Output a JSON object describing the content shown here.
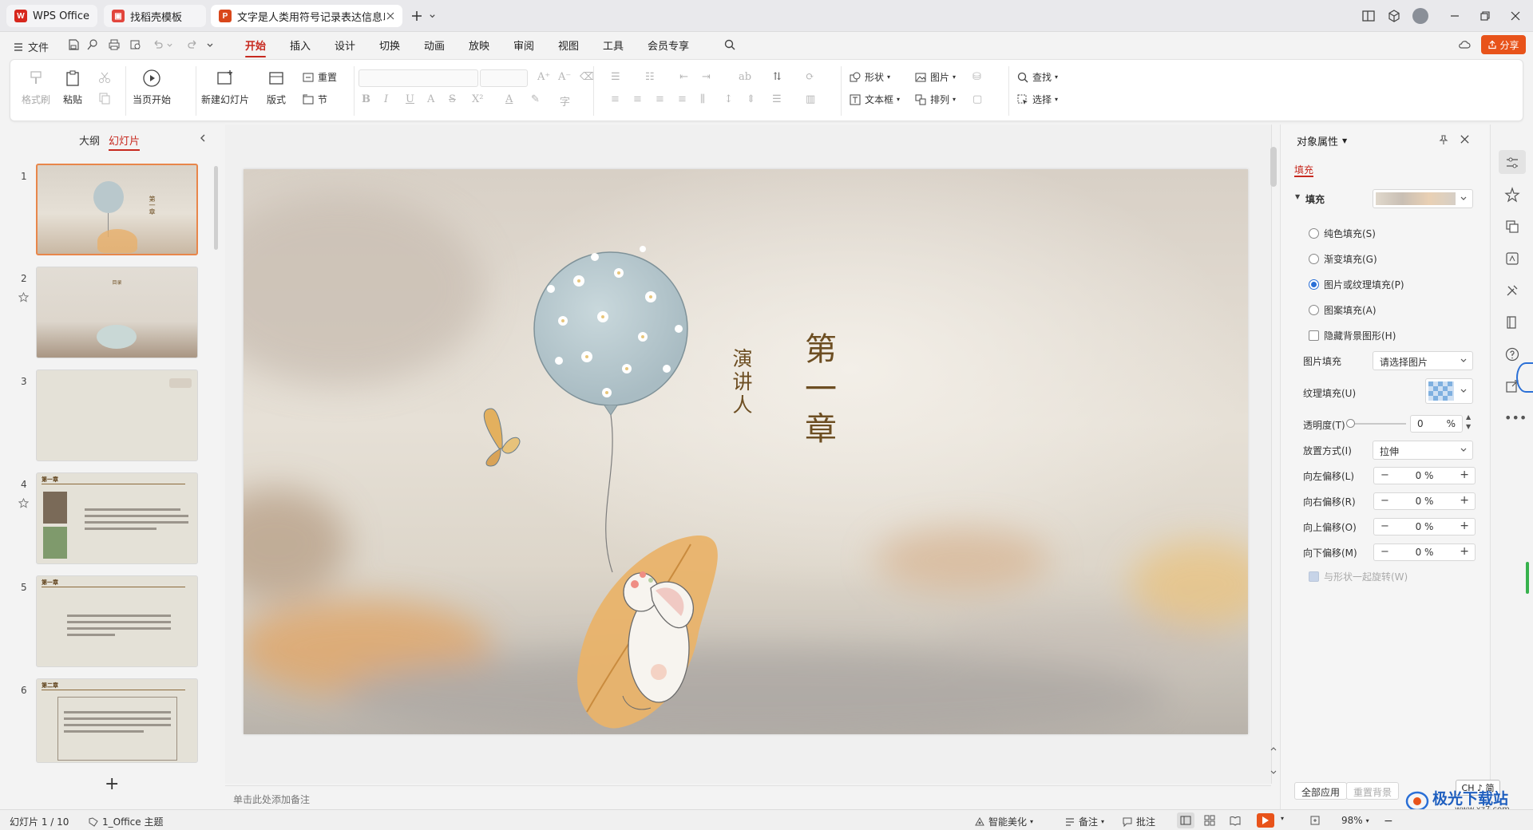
{
  "tabs": [
    {
      "label": "WPS Office",
      "icon": "wps-logo-icon"
    },
    {
      "label": "找稻壳模板",
      "icon": "docer-icon"
    },
    {
      "label": "文字是人类用符号记录表达信息以",
      "icon": "ppt-file-icon"
    }
  ],
  "menu": {
    "file": "文件",
    "items": [
      "开始",
      "插入",
      "设计",
      "切换",
      "动画",
      "放映",
      "审阅",
      "视图",
      "工具",
      "会员专享"
    ],
    "share": "分享"
  },
  "ribbon": {
    "format_painter": "格式刷",
    "paste": "粘贴",
    "play_from_current": "当页开始",
    "new_slide": "新建幻灯片",
    "layout": "版式",
    "reset": "重置",
    "section": "节",
    "shape": "形状",
    "picture": "图片",
    "textbox": "文本框",
    "arrange": "排列",
    "find": "查找",
    "select": "选择"
  },
  "left_panel": {
    "tab_outline": "大纲",
    "tab_slides": "幻灯片",
    "thumbs": [
      {
        "num": "1",
        "title": "第一章"
      },
      {
        "num": "2",
        "title": "目录"
      },
      {
        "num": "3",
        "title": ""
      },
      {
        "num": "4",
        "title": "第一章"
      },
      {
        "num": "5",
        "title": "第一章"
      },
      {
        "num": "6",
        "title": "第二章"
      }
    ],
    "add": "+"
  },
  "slide": {
    "title": "第一章",
    "speaker": "演讲人"
  },
  "notes_placeholder": "单击此处添加备注",
  "props": {
    "header": "对象属性",
    "tab_fill": "填充",
    "section_fill": "填充",
    "options": [
      "纯色填充(S)",
      "渐变填充(G)",
      "图片或纹理填充(P)",
      "图案填充(A)"
    ],
    "selected_option": "图片或纹理填充(P)",
    "hide_bg": "隐藏背景图形(H)",
    "pic_fill_label": "图片填充",
    "pic_fill_value": "请选择图片",
    "texture_label": "纹理填充(U)",
    "transparency_label": "透明度(T)",
    "transparency_value": "0",
    "transparency_unit": "%",
    "placement_label": "放置方式(I)",
    "placement_value": "拉伸",
    "offsets": [
      {
        "label": "向左偏移(L)",
        "value": "0 %"
      },
      {
        "label": "向右偏移(R)",
        "value": "0 %"
      },
      {
        "label": "向上偏移(O)",
        "value": "0 %"
      },
      {
        "label": "向下偏移(M)",
        "value": "0 %"
      }
    ],
    "rotate_with_shape": "与形状一起旋转(W)",
    "apply_all": "全部应用",
    "reset_bg": "重置背景"
  },
  "ime": "CH ♪ 简",
  "watermark": "极光下载站",
  "watermark_url": "www.xz7.com",
  "status": {
    "slide_info": "幻灯片 1 / 10",
    "theme": "1_Office 主题",
    "beautify": "智能美化",
    "notes": "备注",
    "comments": "批注",
    "zoom": "98%"
  },
  "colors": {
    "accent": "#c7291f",
    "share": "#e8531a",
    "title_brown": "#6d4e22"
  }
}
